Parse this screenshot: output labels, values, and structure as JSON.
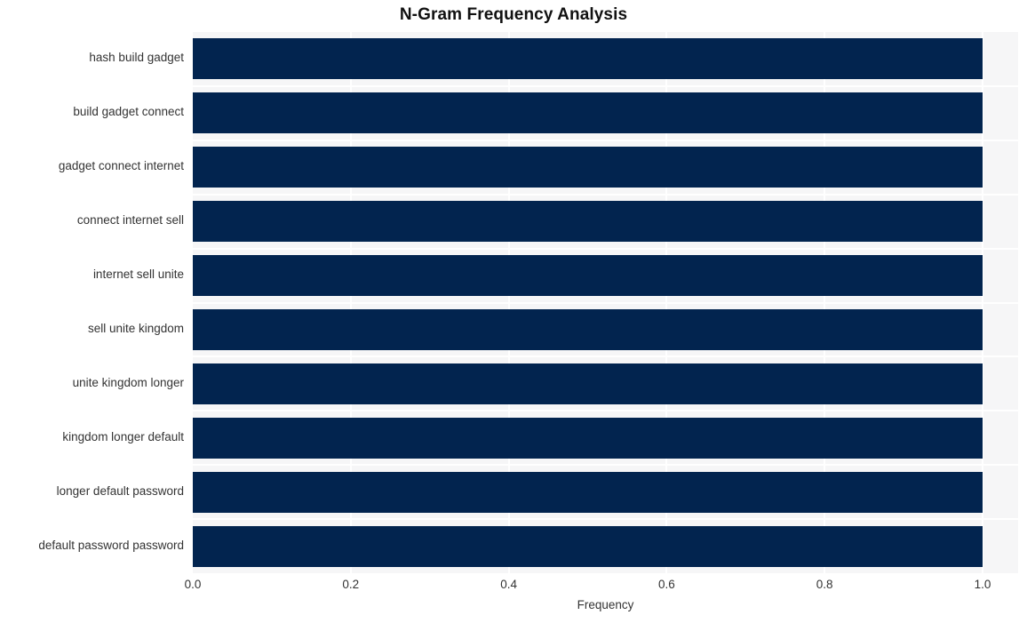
{
  "chart_data": {
    "type": "bar",
    "orientation": "horizontal",
    "title": "N-Gram Frequency Analysis",
    "xlabel": "Frequency",
    "ylabel": "",
    "categories": [
      "hash build gadget",
      "build gadget connect",
      "gadget connect internet",
      "connect internet sell",
      "internet sell unite",
      "sell unite kingdom",
      "unite kingdom longer",
      "kingdom longer default",
      "longer default password",
      "default password password"
    ],
    "values": [
      1.0,
      1.0,
      1.0,
      1.0,
      1.0,
      1.0,
      1.0,
      1.0,
      1.0,
      1.0
    ],
    "xticks": [
      "0.0",
      "0.2",
      "0.4",
      "0.6",
      "0.8",
      "1.0"
    ],
    "xtick_values": [
      0.0,
      0.2,
      0.4,
      0.6,
      0.8,
      1.0
    ],
    "xlim": [
      0.0,
      1.045
    ],
    "grid": true,
    "grid_axis": "both",
    "legend": null,
    "colors": {
      "bar": "#02244f",
      "plot_background": "#f6f6f7",
      "gridline": "#ffffff",
      "figure_background": "#ffffff",
      "text": "#333333",
      "title": "#111111"
    }
  }
}
